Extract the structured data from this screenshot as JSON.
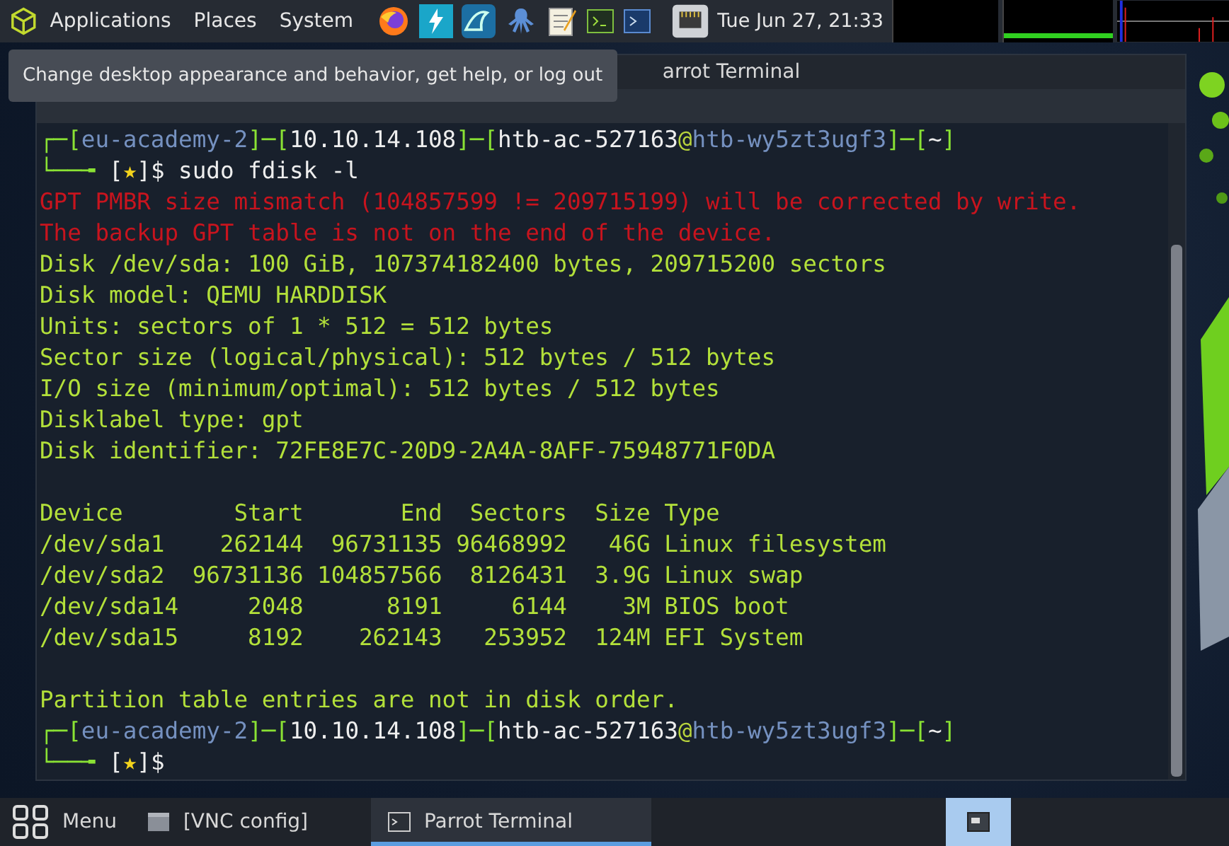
{
  "top_panel": {
    "menus": [
      {
        "label": "Applications"
      },
      {
        "label": "Places"
      },
      {
        "label": "System"
      }
    ],
    "launchers": [
      {
        "kind": "firefox"
      },
      {
        "kind": "bolt"
      },
      {
        "kind": "fin"
      },
      {
        "kind": "kraken"
      },
      {
        "kind": "notepad"
      },
      {
        "kind": "terminal"
      },
      {
        "kind": "powershell"
      }
    ],
    "clock": "Tue Jun 27, 21:33"
  },
  "tooltip": "Change desktop appearance and behavior, get help, or log out",
  "terminal": {
    "title": "arrot Terminal",
    "lines": [
      {
        "kind": "text",
        "segments": [
          {
            "text": "┌─[",
            "kind": "frame"
          },
          {
            "text": "eu-academy-2",
            "kind": "host"
          },
          {
            "text": "]─[",
            "kind": "frame"
          },
          {
            "text": "10.10.14.108",
            "kind": "plain"
          },
          {
            "text": "]─[",
            "kind": "frame"
          },
          {
            "text": "htb-ac-527163",
            "kind": "plain"
          },
          {
            "text": "@",
            "kind": "at"
          },
          {
            "text": "htb-wy5zt3ugf3",
            "kind": "host"
          },
          {
            "text": "]─[",
            "kind": "frame"
          },
          {
            "text": "~",
            "kind": "plain"
          },
          {
            "text": "]",
            "kind": "frame"
          }
        ]
      },
      {
        "kind": "text",
        "segments": [
          {
            "text": "└──╼ ",
            "kind": "frame"
          },
          {
            "text": "[",
            "kind": "plain"
          },
          {
            "text": "★",
            "kind": "star"
          },
          {
            "text": "]$ sudo fdisk -l",
            "kind": "plain"
          }
        ]
      },
      {
        "kind": "text",
        "segments": [
          {
            "text": "GPT PMBR size mismatch (104857599 != 209715199) will be corrected by write.",
            "kind": "error"
          }
        ]
      },
      {
        "kind": "text",
        "segments": [
          {
            "text": "The backup GPT table is not on the end of the device.",
            "kind": "error"
          }
        ]
      },
      {
        "kind": "text",
        "segments": [
          {
            "text": "Disk /dev/sda: 100 GiB, 107374182400 bytes, 209715200 sectors",
            "kind": "output"
          }
        ]
      },
      {
        "kind": "text",
        "segments": [
          {
            "text": "Disk model: QEMU HARDDISK",
            "kind": "output"
          }
        ]
      },
      {
        "kind": "text",
        "segments": [
          {
            "text": "Units: sectors of 1 * 512 = 512 bytes",
            "kind": "output"
          }
        ]
      },
      {
        "kind": "text",
        "segments": [
          {
            "text": "Sector size (logical/physical): 512 bytes / 512 bytes",
            "kind": "output"
          }
        ]
      },
      {
        "kind": "text",
        "segments": [
          {
            "text": "I/O size (minimum/optimal): 512 bytes / 512 bytes",
            "kind": "output"
          }
        ]
      },
      {
        "kind": "text",
        "segments": [
          {
            "text": "Disklabel type: gpt",
            "kind": "output"
          }
        ]
      },
      {
        "kind": "text",
        "segments": [
          {
            "text": "Disk identifier: 72FE8E7C-20D9-2A4A-8AFF-75948771F0DA",
            "kind": "output"
          }
        ]
      },
      {
        "kind": "blank"
      },
      {
        "kind": "text",
        "segments": [
          {
            "text": "Device        Start       End  Sectors  Size Type",
            "kind": "output"
          }
        ]
      },
      {
        "kind": "text",
        "segments": [
          {
            "text": "/dev/sda1    262144  96731135 96468992   46G Linux filesystem",
            "kind": "output"
          }
        ]
      },
      {
        "kind": "text",
        "segments": [
          {
            "text": "/dev/sda2  96731136 104857566  8126431  3.9G Linux swap",
            "kind": "output"
          }
        ]
      },
      {
        "kind": "text",
        "segments": [
          {
            "text": "/dev/sda14     2048      8191     6144    3M BIOS boot",
            "kind": "output"
          }
        ]
      },
      {
        "kind": "text",
        "segments": [
          {
            "text": "/dev/sda15     8192    262143   253952  124M EFI System",
            "kind": "output"
          }
        ]
      },
      {
        "kind": "blank"
      },
      {
        "kind": "text",
        "segments": [
          {
            "text": "Partition table entries are not in disk order.",
            "kind": "output"
          }
        ]
      },
      {
        "kind": "text",
        "segments": [
          {
            "text": "┌─[",
            "kind": "frame"
          },
          {
            "text": "eu-academy-2",
            "kind": "host"
          },
          {
            "text": "]─[",
            "kind": "frame"
          },
          {
            "text": "10.10.14.108",
            "kind": "plain"
          },
          {
            "text": "]─[",
            "kind": "frame"
          },
          {
            "text": "htb-ac-527163",
            "kind": "plain"
          },
          {
            "text": "@",
            "kind": "at"
          },
          {
            "text": "htb-wy5zt3ugf3",
            "kind": "host"
          },
          {
            "text": "]─[",
            "kind": "frame"
          },
          {
            "text": "~",
            "kind": "plain"
          },
          {
            "text": "]",
            "kind": "frame"
          }
        ]
      },
      {
        "kind": "text",
        "segments": [
          {
            "text": "└──╼ ",
            "kind": "frame"
          },
          {
            "text": "[",
            "kind": "plain"
          },
          {
            "text": "★",
            "kind": "star"
          },
          {
            "text": "]$",
            "kind": "plain"
          }
        ]
      }
    ]
  },
  "taskbar": {
    "menu": "Menu",
    "windows": [
      {
        "label": "[VNC config]",
        "kind": "window",
        "selected": false
      },
      {
        "label": "Parrot Terminal",
        "kind": "terminal",
        "selected": true
      }
    ]
  }
}
